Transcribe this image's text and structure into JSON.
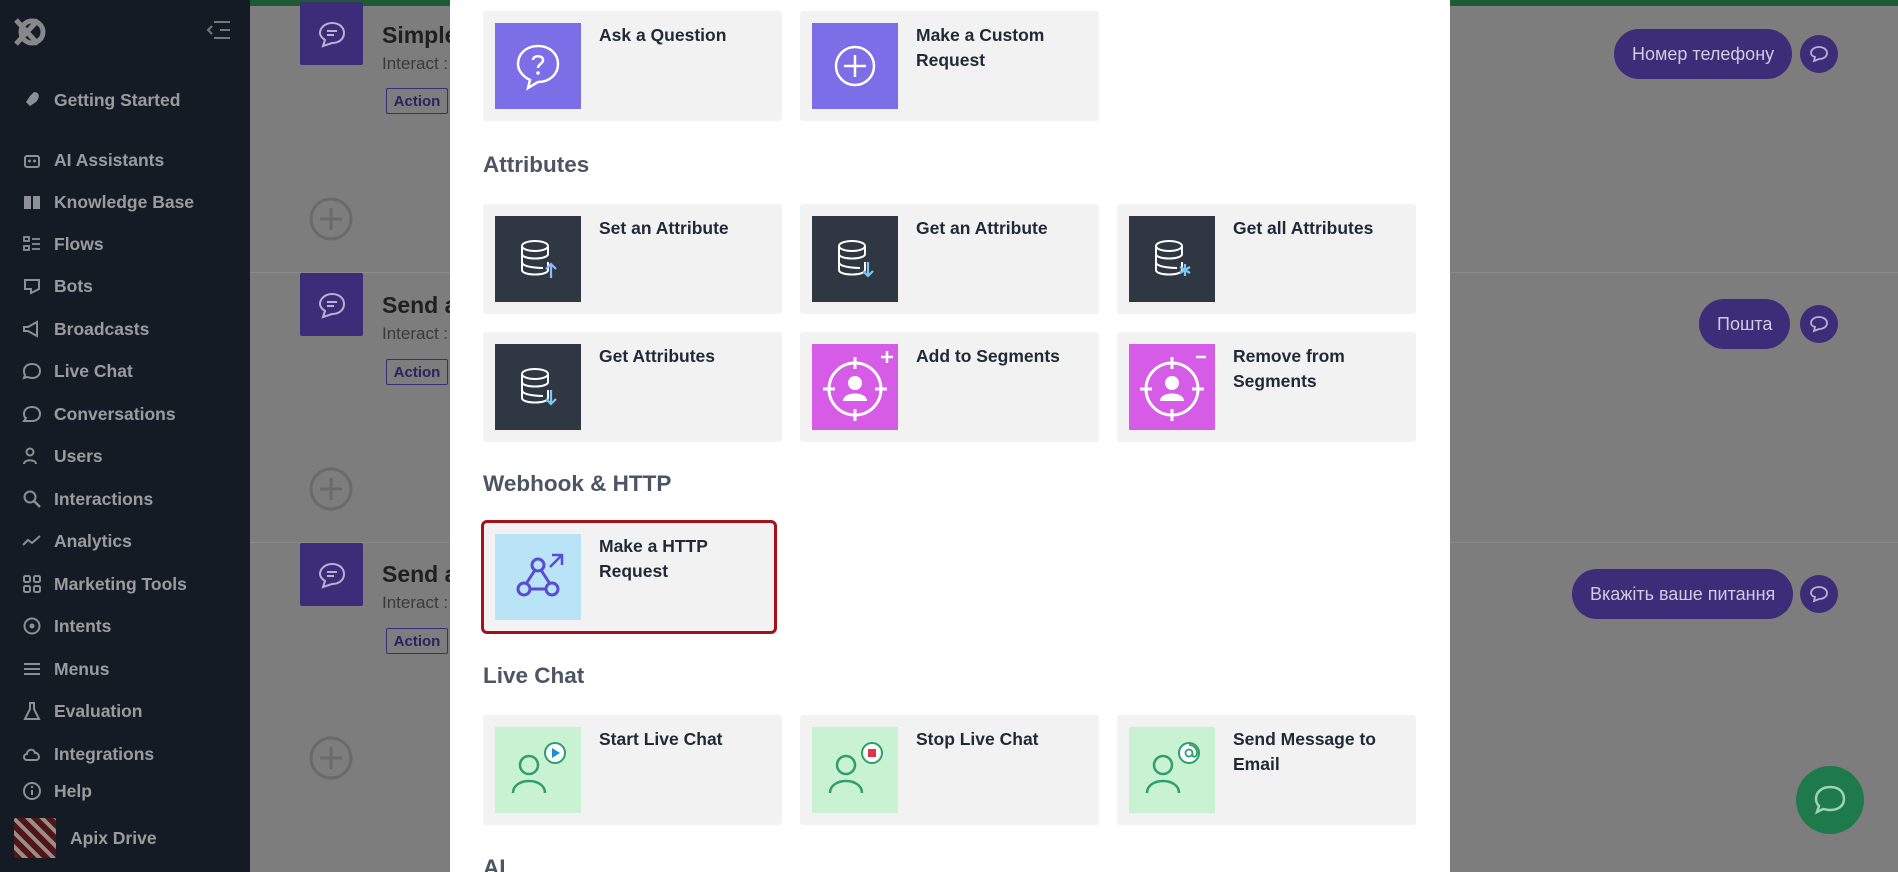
{
  "sidebar": {
    "items": [
      {
        "label": "Getting Started",
        "icon": "rocket-icon"
      },
      {
        "label": "AI Assistants",
        "icon": "robot-icon"
      },
      {
        "label": "Knowledge Base",
        "icon": "book-icon"
      },
      {
        "label": "Flows",
        "icon": "flows-icon"
      },
      {
        "label": "Bots",
        "icon": "bot-icon"
      },
      {
        "label": "Broadcasts",
        "icon": "megaphone-icon"
      },
      {
        "label": "Live Chat",
        "icon": "chat-icon"
      },
      {
        "label": "Conversations",
        "icon": "conversation-icon"
      },
      {
        "label": "Users",
        "icon": "users-icon"
      },
      {
        "label": "Interactions",
        "icon": "search-icon"
      },
      {
        "label": "Analytics",
        "icon": "analytics-icon"
      },
      {
        "label": "Marketing Tools",
        "icon": "grid-icon"
      },
      {
        "label": "Intents",
        "icon": "target-icon"
      },
      {
        "label": "Menus",
        "icon": "menu-icon"
      },
      {
        "label": "Evaluation",
        "icon": "flask-icon"
      },
      {
        "label": "Integrations",
        "icon": "cloud-icon"
      },
      {
        "label": "Help",
        "icon": "info-icon"
      }
    ],
    "user_name": "Apix Drive"
  },
  "background": {
    "flows": [
      {
        "title": "Simple",
        "subtitle": "Interact :",
        "tag": "Action",
        "pill": "Номер телефону"
      },
      {
        "title": "Send a",
        "subtitle": "Interact :",
        "tag": "Action",
        "pill": "Пошта"
      },
      {
        "title": "Send a",
        "subtitle": "Interact :",
        "tag": "Action",
        "pill": "Вкажіть ваше питання"
      }
    ]
  },
  "modal": {
    "top_tiles": [
      {
        "label": "Ask a Question",
        "icon": "question-bubble-icon"
      },
      {
        "label": "Make a Custom Request",
        "icon": "plus-circle-icon"
      }
    ],
    "sections": {
      "attributes": "Attributes",
      "webhook": "Webhook & HTTP",
      "live_chat": "Live Chat",
      "ai": "AI"
    },
    "attribute_tiles": [
      {
        "label": "Set an Attribute",
        "icon": "database-up-icon"
      },
      {
        "label": "Get an Attribute",
        "icon": "database-down-icon"
      },
      {
        "label": "Get all Attributes",
        "icon": "database-star-icon"
      },
      {
        "label": "Get Attributes",
        "icon": "database-down-icon"
      },
      {
        "label": "Add to Segments",
        "icon": "segment-add-icon"
      },
      {
        "label": "Remove from Segments",
        "icon": "segment-remove-icon"
      }
    ],
    "webhook_tiles": [
      {
        "label": "Make a HTTP Request",
        "icon": "webhook-icon",
        "selected": true
      }
    ],
    "live_chat_tiles": [
      {
        "label": "Start Live Chat",
        "icon": "agent-play-icon"
      },
      {
        "label": "Stop Live Chat",
        "icon": "agent-stop-icon"
      },
      {
        "label": "Send Message to Email",
        "icon": "agent-email-icon"
      }
    ]
  },
  "colors": {
    "sidebar_bg": "#1f2937",
    "flow_purple": "#3b2d77",
    "ask_purple": "#7b6ee6",
    "database_dark": "#2f3742",
    "segment_magenta": "#d65ce8",
    "webhook_light_blue": "#b9e4f7",
    "livechat_green": "#c8f2d2",
    "selection_red": "#a3121a"
  }
}
